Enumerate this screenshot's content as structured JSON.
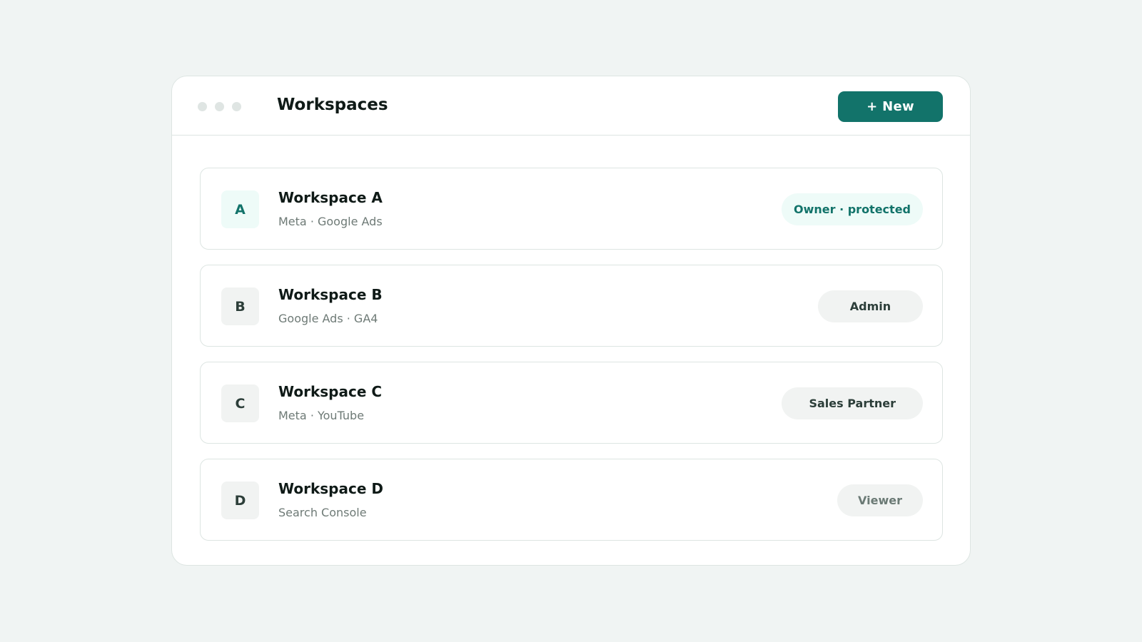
{
  "window": {
    "title": "Workspaces",
    "new_button_label": "+ New"
  },
  "workspaces": [
    {
      "initial": "A",
      "name": "Workspace A",
      "integrations": "Meta · Google Ads",
      "role": "Owner · protected"
    },
    {
      "initial": "B",
      "name": "Workspace B",
      "integrations": "Google Ads · GA4",
      "role": "Admin"
    },
    {
      "initial": "C",
      "name": "Workspace C",
      "integrations": "Meta · YouTube",
      "role": "Sales Partner"
    },
    {
      "initial": "D",
      "name": "Workspace D",
      "integrations": "Search Console",
      "role": "Viewer"
    }
  ],
  "colors": {
    "accent": "#12736a",
    "accent_soft": "#eefbf8",
    "neutral_chip": "#f1f3f2",
    "background": "#f0f4f3"
  }
}
